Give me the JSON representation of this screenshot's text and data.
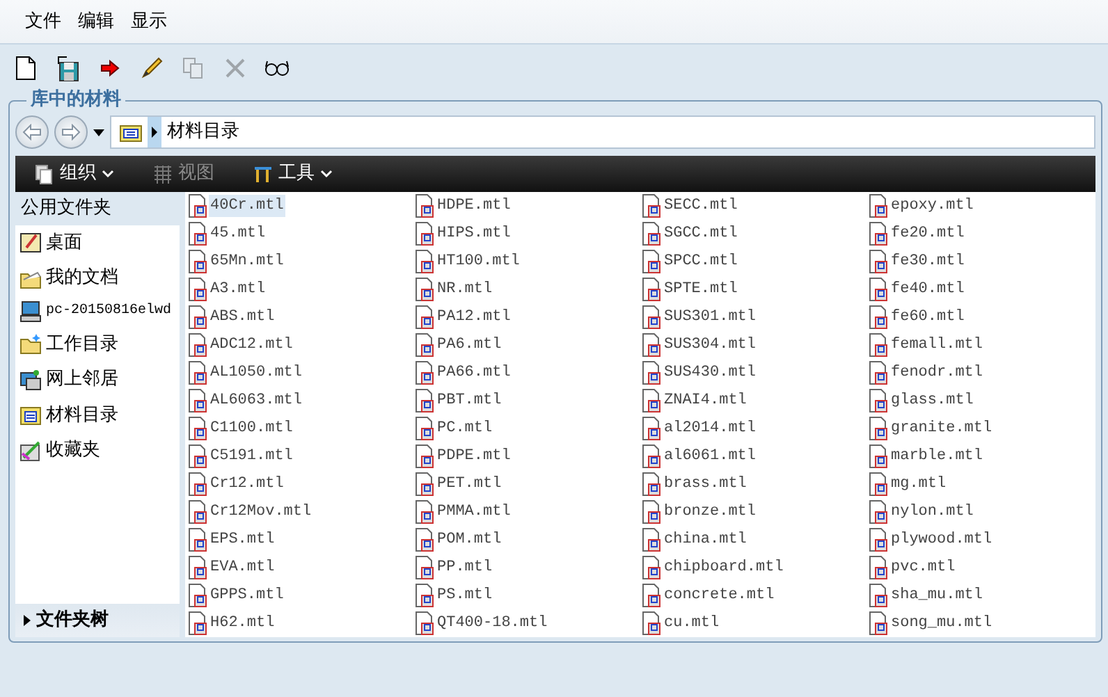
{
  "menu": [
    "文件",
    "编辑",
    "显示"
  ],
  "toolbar": [
    {
      "kind": "new",
      "disabled": false
    },
    {
      "kind": "save",
      "disabled": false
    },
    {
      "kind": "arrow",
      "disabled": false
    },
    {
      "kind": "pencil",
      "disabled": false
    },
    {
      "kind": "copy",
      "disabled": true
    },
    {
      "kind": "delete",
      "disabled": true
    },
    {
      "kind": "glasses",
      "disabled": false
    }
  ],
  "group_title": "库中的材料",
  "address": {
    "path": "材料目录"
  },
  "command_bar": [
    {
      "label": "组织",
      "kind": "organize",
      "dropdown": true,
      "disabled": false
    },
    {
      "label": "视图",
      "kind": "view",
      "dropdown": false,
      "disabled": true
    },
    {
      "label": "工具",
      "kind": "tools",
      "dropdown": true,
      "disabled": false
    }
  ],
  "sidebar": {
    "header": "公用文件夹",
    "items": [
      {
        "label": "桌面",
        "kind": "desktop"
      },
      {
        "label": "我的文档",
        "kind": "documents"
      },
      {
        "label": "pc-20150816elwd",
        "kind": "computer"
      },
      {
        "label": "工作目录",
        "kind": "workfolder"
      },
      {
        "label": "网上邻居",
        "kind": "network"
      },
      {
        "label": "材料目录",
        "kind": "library"
      },
      {
        "label": "收藏夹",
        "kind": "favorites"
      }
    ],
    "footer": "文件夹树"
  },
  "files": [
    {
      "name": "40Cr.mtl",
      "selected": true
    },
    {
      "name": "45.mtl",
      "selected": false
    },
    {
      "name": "65Mn.mtl",
      "selected": false
    },
    {
      "name": "A3.mtl",
      "selected": false
    },
    {
      "name": "ABS.mtl",
      "selected": false
    },
    {
      "name": "ADC12.mtl",
      "selected": false
    },
    {
      "name": "AL1050.mtl",
      "selected": false
    },
    {
      "name": "AL6063.mtl",
      "selected": false
    },
    {
      "name": "C1100.mtl",
      "selected": false
    },
    {
      "name": "C5191.mtl",
      "selected": false
    },
    {
      "name": "Cr12.mtl",
      "selected": false
    },
    {
      "name": "Cr12Mov.mtl",
      "selected": false
    },
    {
      "name": "EPS.mtl",
      "selected": false
    },
    {
      "name": "EVA.mtl",
      "selected": false
    },
    {
      "name": "GPPS.mtl",
      "selected": false
    },
    {
      "name": "H62.mtl",
      "selected": false
    },
    {
      "name": "HDPE.mtl",
      "selected": false
    },
    {
      "name": "HIPS.mtl",
      "selected": false
    },
    {
      "name": "HT100.mtl",
      "selected": false
    },
    {
      "name": "NR.mtl",
      "selected": false
    },
    {
      "name": "PA12.mtl",
      "selected": false
    },
    {
      "name": "PA6.mtl",
      "selected": false
    },
    {
      "name": "PA66.mtl",
      "selected": false
    },
    {
      "name": "PBT.mtl",
      "selected": false
    },
    {
      "name": "PC.mtl",
      "selected": false
    },
    {
      "name": "PDPE.mtl",
      "selected": false
    },
    {
      "name": "PET.mtl",
      "selected": false
    },
    {
      "name": "PMMA.mtl",
      "selected": false
    },
    {
      "name": "POM.mtl",
      "selected": false
    },
    {
      "name": "PP.mtl",
      "selected": false
    },
    {
      "name": "PS.mtl",
      "selected": false
    },
    {
      "name": "QT400-18.mtl",
      "selected": false
    },
    {
      "name": "SECC.mtl",
      "selected": false
    },
    {
      "name": "SGCC.mtl",
      "selected": false
    },
    {
      "name": "SPCC.mtl",
      "selected": false
    },
    {
      "name": "SPTE.mtl",
      "selected": false
    },
    {
      "name": "SUS301.mtl",
      "selected": false
    },
    {
      "name": "SUS304.mtl",
      "selected": false
    },
    {
      "name": "SUS430.mtl",
      "selected": false
    },
    {
      "name": "ZNAI4.mtl",
      "selected": false
    },
    {
      "name": "al2014.mtl",
      "selected": false
    },
    {
      "name": "al6061.mtl",
      "selected": false
    },
    {
      "name": "brass.mtl",
      "selected": false
    },
    {
      "name": "bronze.mtl",
      "selected": false
    },
    {
      "name": "china.mtl",
      "selected": false
    },
    {
      "name": "chipboard.mtl",
      "selected": false
    },
    {
      "name": "concrete.mtl",
      "selected": false
    },
    {
      "name": "cu.mtl",
      "selected": false
    },
    {
      "name": "epoxy.mtl",
      "selected": false
    },
    {
      "name": "fe20.mtl",
      "selected": false
    },
    {
      "name": "fe30.mtl",
      "selected": false
    },
    {
      "name": "fe40.mtl",
      "selected": false
    },
    {
      "name": "fe60.mtl",
      "selected": false
    },
    {
      "name": "femall.mtl",
      "selected": false
    },
    {
      "name": "fenodr.mtl",
      "selected": false
    },
    {
      "name": "glass.mtl",
      "selected": false
    },
    {
      "name": "granite.mtl",
      "selected": false
    },
    {
      "name": "marble.mtl",
      "selected": false
    },
    {
      "name": "mg.mtl",
      "selected": false
    },
    {
      "name": "nylon.mtl",
      "selected": false
    },
    {
      "name": "plywood.mtl",
      "selected": false
    },
    {
      "name": "pvc.mtl",
      "selected": false
    },
    {
      "name": "sha_mu.mtl",
      "selected": false
    },
    {
      "name": "song_mu.mtl",
      "selected": false
    }
  ]
}
